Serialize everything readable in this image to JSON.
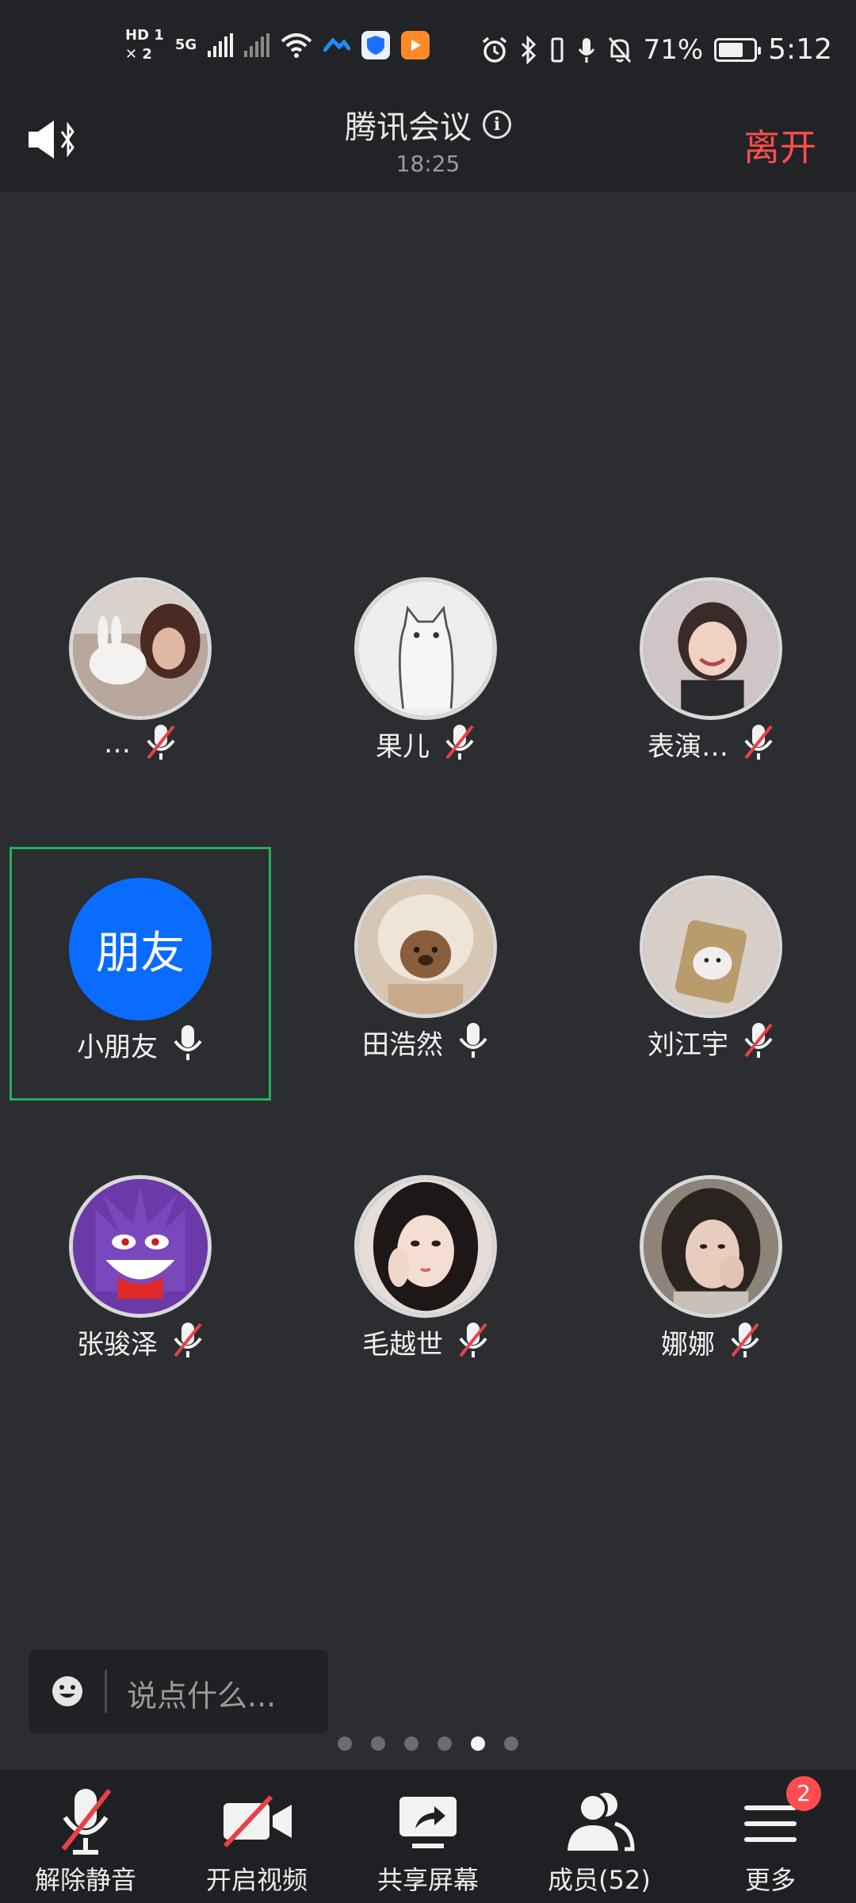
{
  "status_bar": {
    "hd_label": "HD",
    "sim1": "1",
    "sim2": "2",
    "network": "5G",
    "battery_text": "71%",
    "time": "5:12"
  },
  "header": {
    "title": "腾讯会议",
    "timer": "18:25",
    "leave_label": "离开",
    "leave_color": "#ff4d4f"
  },
  "participants": [
    {
      "name": "…",
      "muted": true,
      "avatar_icon": "photo-girl-with-rabbit"
    },
    {
      "name": "果儿",
      "muted": true,
      "avatar_icon": "sketch-cat"
    },
    {
      "name": "表演…",
      "muted": true,
      "avatar_icon": "photo-smiling-child"
    },
    {
      "name": "小朋友",
      "muted": false,
      "avatar_text": "朋友",
      "active": true
    },
    {
      "name": "田浩然",
      "muted": false,
      "avatar_icon": "photo-teddy-bear"
    },
    {
      "name": "刘江宇",
      "muted": true,
      "avatar_icon": "photo-small-animal"
    },
    {
      "name": "张骏泽",
      "muted": true,
      "avatar_icon": "purple-monster-cartoon"
    },
    {
      "name": "毛越世",
      "muted": true,
      "avatar_icon": "photo-girl-portrait"
    },
    {
      "name": "娜娜",
      "muted": true,
      "avatar_icon": "photo-girl-selfie"
    }
  ],
  "chat": {
    "placeholder": "说点什么..."
  },
  "pagination": {
    "total": 6,
    "current": 5
  },
  "toolbar": {
    "unmute_label": "解除静音",
    "video_label": "开启视频",
    "share_label": "共享屏幕",
    "members_label": "成员(52)",
    "more_label": "更多",
    "more_badge": "2"
  },
  "colors": {
    "accent_blue": "#0a6cff",
    "active_border": "#23b05a",
    "muted_red": "#e8414a"
  }
}
